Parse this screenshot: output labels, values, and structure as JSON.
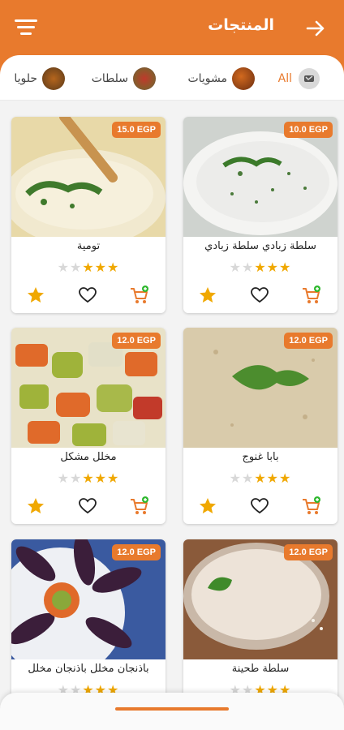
{
  "header": {
    "title": "المنتجات",
    "menu_icon": "filter-menu-icon",
    "back_icon": "arrow-right-icon"
  },
  "categories": [
    {
      "label": "All",
      "icon": "all-icon",
      "active": true
    },
    {
      "label": "مشويات",
      "icon": "grill-thumb"
    },
    {
      "label": "سلطات",
      "icon": "salad-thumb"
    },
    {
      "label": "حلويا",
      "icon": "dessert-thumb"
    }
  ],
  "products": [
    {
      "name": "سلطة زبادي سلطة زبادي",
      "price": "10.0 EGP",
      "rating": 3,
      "max": 5
    },
    {
      "name": "تومية",
      "price": "15.0 EGP",
      "rating": 3,
      "max": 5
    },
    {
      "name": "بابا غنوج",
      "price": "12.0 EGP",
      "rating": 3,
      "max": 5
    },
    {
      "name": "مخلل مشكل",
      "price": "12.0 EGP",
      "rating": 3,
      "max": 5
    },
    {
      "name": "سلطة طحينة",
      "price": "12.0 EGP",
      "rating": 3,
      "max": 5
    },
    {
      "name": "باذنجان مخلل باذنجان مخلل",
      "price": "12.0 EGP",
      "rating": 3,
      "max": 5
    }
  ],
  "colors": {
    "accent": "#e87a2d",
    "star": "#f0a800",
    "cart": "#e87a2d",
    "cart_plus": "#2eb82e"
  }
}
